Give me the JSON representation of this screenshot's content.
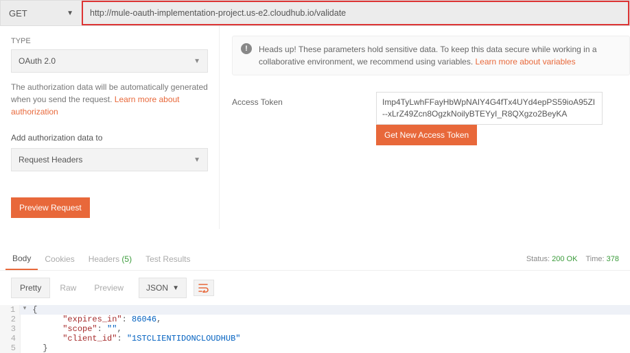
{
  "topbar": {
    "method": "GET",
    "url": "http://mule-oauth-implementation-project.us-e2.cloudhub.io/validate"
  },
  "auth": {
    "type_label": "TYPE",
    "type_value": "OAuth 2.0",
    "help_text_prefix": "The authorization data will be automatically generated when you send the request. ",
    "help_link": "Learn more about authorization",
    "add_to_label": "Add authorization data to",
    "add_to_value": "Request Headers",
    "preview_btn": "Preview Request"
  },
  "alert": {
    "text_prefix": "Heads up! These parameters hold sensitive data. To keep this data secure while working in a collaborative environment, we recommend using variables. ",
    "link": "Learn more about variables"
  },
  "token": {
    "label": "Access Token",
    "value": "Imp4TyLwhFFayHbWpNAIY4G4fTx4UYd4epPS59ioA95ZI--xLrZ49Zcn8OgzkNoilyBTEYyI_R8QXgzo2BeyKA",
    "get_new_btn": "Get New Access Token"
  },
  "response": {
    "tabs": {
      "body": "Body",
      "cookies": "Cookies",
      "headers": "Headers",
      "headers_count": "(5)",
      "tests": "Test Results"
    },
    "status_label": "Status:",
    "status_value": "200 OK",
    "time_label": "Time:",
    "time_value": "378",
    "view": {
      "pretty": "Pretty",
      "raw": "Raw",
      "preview": "Preview",
      "format": "JSON"
    },
    "body": {
      "line1": "{",
      "line2_key": "\"expires_in\"",
      "line2_val": "86046",
      "line3_key": "\"scope\"",
      "line3_val": "\"\"",
      "line4_key": "\"client_id\"",
      "line4_val": "\"1STCLIENTIDONCLOUDHUB\"",
      "line5": "}"
    }
  }
}
